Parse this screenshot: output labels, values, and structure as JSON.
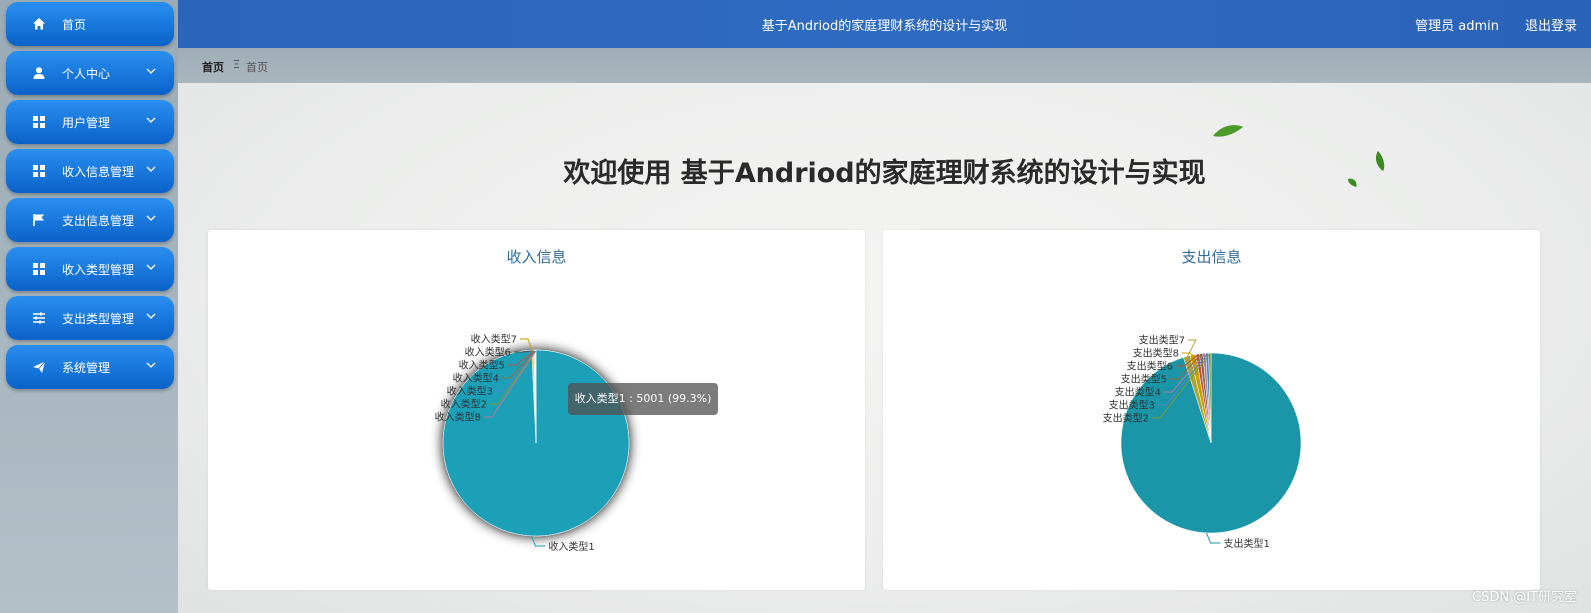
{
  "sidebar": {
    "items": [
      {
        "label": "首页",
        "icon": "home-icon",
        "has_chevron": false
      },
      {
        "label": "个人中心",
        "icon": "user-icon",
        "has_chevron": true
      },
      {
        "label": "用户管理",
        "icon": "grid-icon",
        "has_chevron": true
      },
      {
        "label": "收入信息管理",
        "icon": "grid-icon",
        "has_chevron": true
      },
      {
        "label": "支出信息管理",
        "icon": "flag-icon",
        "has_chevron": true
      },
      {
        "label": "收入类型管理",
        "icon": "grid-icon",
        "has_chevron": true
      },
      {
        "label": "支出类型管理",
        "icon": "sliders-icon",
        "has_chevron": true
      },
      {
        "label": "系统管理",
        "icon": "send-icon",
        "has_chevron": true
      }
    ]
  },
  "header": {
    "title": "基于Andriod的家庭理财系统的设计与实现",
    "admin": "管理员 admin",
    "logout": "退出登录"
  },
  "breadcrumb": {
    "home": "首页",
    "separator": "Ξ",
    "current": "首页"
  },
  "welcome": "欢迎使用 基于Andriod的家庭理财系统的设计与实现",
  "income_card": {
    "title": "收入信息"
  },
  "expense_card": {
    "title": "支出信息"
  },
  "tooltip": "收入类型1 : 5001 (99.3%)",
  "watermark": "CSDN @IT研究室",
  "colors": {
    "primary_nav": "#0a62c9",
    "header": "#2f6bc2",
    "income_main": "#1aa0b8",
    "expense_main": "#1a96a8"
  },
  "chart_data": [
    {
      "type": "pie",
      "title": "收入信息",
      "slices": [
        {
          "label": "收入类型1",
          "value": 5001,
          "color": "#1aa0b8"
        },
        {
          "label": "收入类型7",
          "value": 10,
          "color": "#c6a100"
        },
        {
          "label": "收入类型6",
          "value": 8,
          "color": "#555555"
        },
        {
          "label": "收入类型5",
          "value": 5,
          "color": "#c0504d"
        },
        {
          "label": "收入类型4",
          "value": 5,
          "color": "#8e6b3e"
        },
        {
          "label": "收入类型3",
          "value": 4,
          "color": "#4b88c8"
        },
        {
          "label": "收入类型2",
          "value": 3,
          "color": "#7a9a35"
        },
        {
          "label": "收入类型8",
          "value": 2,
          "color": "#b07aa1"
        }
      ]
    },
    {
      "type": "pie",
      "title": "支出信息",
      "slices": [
        {
          "label": "支出类型1",
          "value": 920,
          "color": "#1a96a8"
        },
        {
          "label": "支出类型7",
          "value": 12,
          "color": "#a8a53a"
        },
        {
          "label": "支出类型8",
          "value": 10,
          "color": "#c6a100"
        },
        {
          "label": "支出类型6",
          "value": 6,
          "color": "#c0504d"
        },
        {
          "label": "支出类型5",
          "value": 6,
          "color": "#8e6b3e"
        },
        {
          "label": "支出类型4",
          "value": 5,
          "color": "#b07aa1"
        },
        {
          "label": "支出类型3",
          "value": 5,
          "color": "#4b88c8"
        },
        {
          "label": "支出类型2",
          "value": 4,
          "color": "#7a9a35"
        }
      ]
    }
  ]
}
